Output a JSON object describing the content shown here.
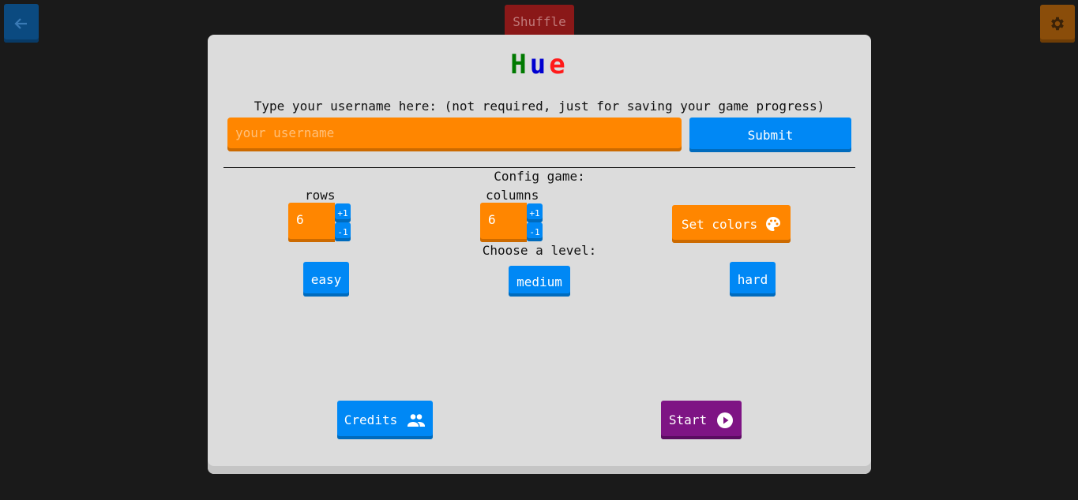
{
  "background": {
    "back_button": {
      "icon": "arrow-left-icon"
    },
    "shuffle_label": "Shuffle",
    "settings_button": {
      "icon": "gear-icon"
    }
  },
  "modal": {
    "title_letters": [
      {
        "char": "H",
        "color": "#007a00"
      },
      {
        "char": "u",
        "color": "#0000d0"
      },
      {
        "char": "e",
        "color": "#ff1a1a"
      }
    ],
    "username": {
      "label": "Type your username here: (not required, just for saving your game progress)",
      "placeholder": "your username",
      "value": "",
      "submit_label": "Submit"
    },
    "config": {
      "heading": "Config game:",
      "rows": {
        "label": "rows",
        "value": "6",
        "plus": "+1",
        "minus": "-1"
      },
      "columns": {
        "label": "columns",
        "value": "6",
        "plus": "+1",
        "minus": "-1"
      },
      "set_colors": {
        "label": "Set colors",
        "icon": "palette-icon"
      }
    },
    "level": {
      "heading": "Choose a level:",
      "options": [
        "easy",
        "medium",
        "hard"
      ],
      "selected": "medium"
    },
    "credits": {
      "label": "Credits",
      "icon": "people-icon"
    },
    "start": {
      "label": "Start",
      "icon": "play-circle-icon"
    }
  },
  "colors": {
    "orange": "#ff8600",
    "blue": "#0088f5",
    "purple": "#7e1484",
    "modal_bg": "#dcdcdc",
    "page_bg": "#1a1a1a"
  }
}
